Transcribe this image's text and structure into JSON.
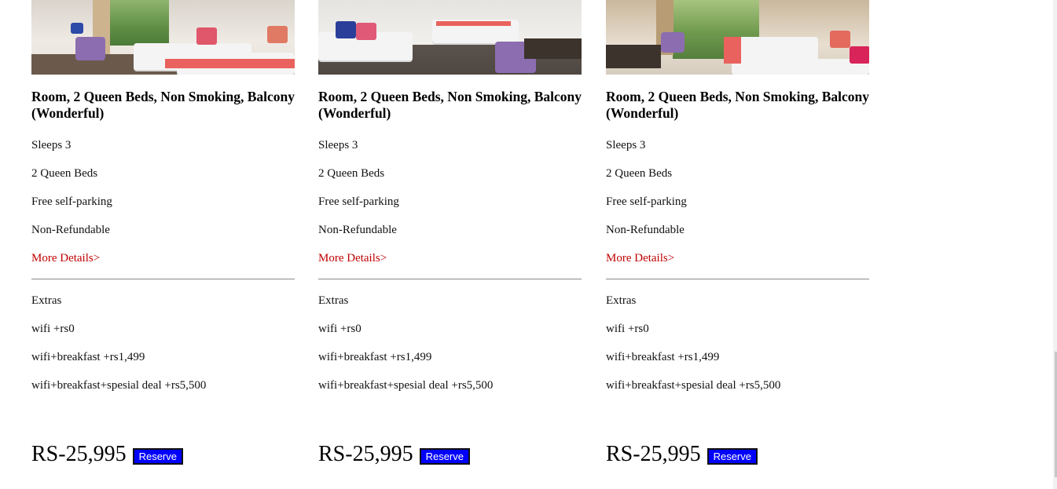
{
  "colors": {
    "link": "#c00000",
    "button_bg": "#0000ff",
    "button_text": "#ffffff"
  },
  "rooms": [
    {
      "title": "Room, 2 Queen Beds, Non Smoking, Balcony (Wonderful)",
      "features": [
        "Sleeps 3",
        "2 Queen Beds",
        "Free self-parking",
        "Non-Refundable"
      ],
      "more_details": "More Details>",
      "extras_heading": "Extras",
      "extras": [
        "wifi +rs0",
        "wifi+breakfast +rs1,499",
        "wifi+breakfast+spesial deal +rs5,500"
      ],
      "price": "RS-25,995",
      "reserve_label": "Reserve"
    },
    {
      "title": "Room, 2 Queen Beds, Non Smoking, Balcony (Wonderful)",
      "features": [
        "Sleeps 3",
        "2 Queen Beds",
        "Free self-parking",
        "Non-Refundable"
      ],
      "more_details": "More Details>",
      "extras_heading": "Extras",
      "extras": [
        "wifi +rs0",
        "wifi+breakfast +rs1,499",
        "wifi+breakfast+spesial deal +rs5,500"
      ],
      "price": "RS-25,995",
      "reserve_label": "Reserve"
    },
    {
      "title": "Room, 2 Queen Beds, Non Smoking, Balcony (Wonderful)",
      "features": [
        "Sleeps 3",
        "2 Queen Beds",
        "Free self-parking",
        "Non-Refundable"
      ],
      "more_details": "More Details>",
      "extras_heading": "Extras",
      "extras": [
        "wifi +rs0",
        "wifi+breakfast +rs1,499",
        "wifi+breakfast+spesial deal +rs5,500"
      ],
      "price": "RS-25,995",
      "reserve_label": "Reserve"
    }
  ]
}
